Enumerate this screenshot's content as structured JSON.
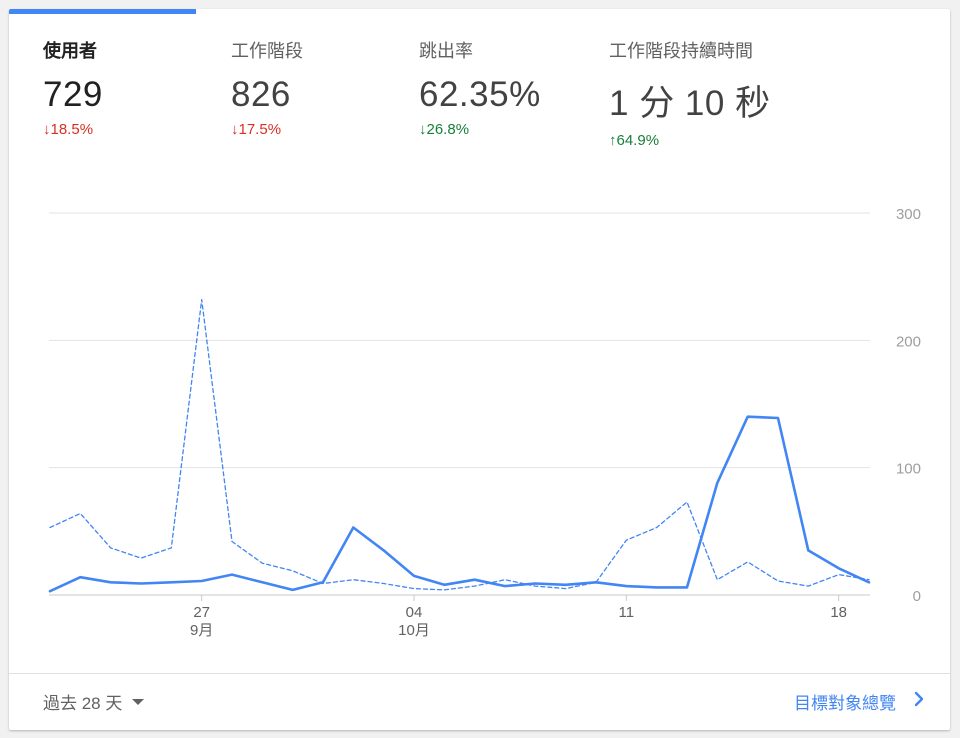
{
  "metrics": [
    {
      "label": "使用者",
      "value": "729",
      "change": "18.5%",
      "arrow": "↓",
      "tone": "down-bad"
    },
    {
      "label": "工作階段",
      "value": "826",
      "change": "17.5%",
      "arrow": "↓",
      "tone": "down-bad"
    },
    {
      "label": "跳出率",
      "value": "62.35%",
      "change": "26.8%",
      "arrow": "↓",
      "tone": "down-good"
    },
    {
      "label": "工作階段持續時間",
      "value": "1 分 10 秒",
      "change": "64.9%",
      "arrow": "↑",
      "tone": "up-good"
    }
  ],
  "footer": {
    "range_label": "過去 28 天",
    "report_link": "目標對象總覽"
  },
  "colors": {
    "accent": "#4285f4",
    "negative": "#d93025",
    "positive": "#188038"
  },
  "chart_data": {
    "type": "line",
    "x": [
      "9/22",
      "9/23",
      "9/24",
      "9/25",
      "9/26",
      "9/27",
      "9/28",
      "9/29",
      "9/30",
      "10/1",
      "10/2",
      "10/3",
      "10/4",
      "10/5",
      "10/6",
      "10/7",
      "10/8",
      "10/9",
      "10/10",
      "10/11",
      "10/12",
      "10/13",
      "10/14",
      "10/15",
      "10/16",
      "10/17",
      "10/18",
      "10/19"
    ],
    "x_ticks": [
      {
        "index": 5,
        "day": "27",
        "month": "9月"
      },
      {
        "index": 12,
        "day": "04",
        "month": "10月"
      },
      {
        "index": 19,
        "day": "11",
        "month": ""
      },
      {
        "index": 26,
        "day": "18",
        "month": ""
      }
    ],
    "y_ticks": [
      "300",
      "200",
      "100",
      "0"
    ],
    "ylim": [
      0,
      300
    ],
    "grid": true,
    "series": [
      {
        "style": "solid",
        "values": [
          3,
          14,
          10,
          9,
          10,
          11,
          16,
          10,
          4,
          10,
          53,
          35,
          15,
          8,
          12,
          7,
          9,
          8,
          10,
          7,
          6,
          6,
          88,
          140,
          139,
          35,
          21,
          10
        ]
      },
      {
        "style": "dashed",
        "values": [
          53,
          64,
          37,
          29,
          37,
          232,
          42,
          25,
          19,
          9,
          12,
          9,
          5,
          4,
          7,
          12,
          7,
          5,
          10,
          43,
          53,
          73,
          12,
          26,
          11,
          7,
          16,
          12
        ]
      }
    ]
  }
}
